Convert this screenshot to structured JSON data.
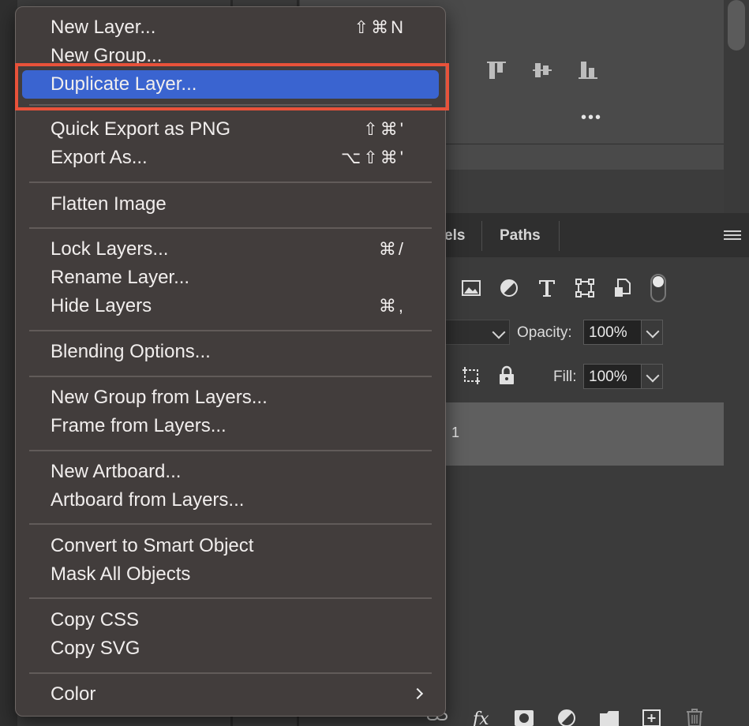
{
  "panels": {
    "tabs": [
      {
        "label": "els"
      },
      {
        "label": "Paths"
      }
    ],
    "opacity": {
      "label": "Opacity:",
      "value": "100%"
    },
    "fill": {
      "label": "Fill:",
      "value": "100%"
    },
    "layer_row_text": "1",
    "more_glyph": "•••"
  },
  "menu": {
    "items": [
      {
        "label": "New Layer...",
        "shortcut": "⇧⌘N"
      },
      {
        "label": "New Group...",
        "shortcut": ""
      },
      {
        "label": "Duplicate Layer...",
        "shortcut": "",
        "selected": true
      },
      {
        "label": "Quick Export as PNG",
        "shortcut": "⇧⌘'"
      },
      {
        "label": "Export As...",
        "shortcut": "⌥⇧⌘'"
      },
      {
        "label": "Flatten Image",
        "shortcut": ""
      },
      {
        "label": "Lock Layers...",
        "shortcut": "⌘/"
      },
      {
        "label": "Rename Layer...",
        "shortcut": ""
      },
      {
        "label": "Hide Layers",
        "shortcut": "⌘,"
      },
      {
        "label": "Blending Options...",
        "shortcut": ""
      },
      {
        "label": "New Group from Layers...",
        "shortcut": ""
      },
      {
        "label": "Frame from Layers...",
        "shortcut": ""
      },
      {
        "label": "New Artboard...",
        "shortcut": ""
      },
      {
        "label": "Artboard from Layers...",
        "shortcut": ""
      },
      {
        "label": "Convert to Smart Object",
        "shortcut": ""
      },
      {
        "label": "Mask All Objects",
        "shortcut": ""
      },
      {
        "label": "Copy CSS",
        "shortcut": ""
      },
      {
        "label": "Copy SVG",
        "shortcut": ""
      },
      {
        "label": "Color",
        "shortcut": "",
        "submenu": true
      }
    ]
  },
  "colors": {
    "menu_bg": "#423d3c",
    "selected_bg": "#3a64d0",
    "highlight_border": "#e8523a",
    "panel_bg": "#3c3c3c"
  }
}
